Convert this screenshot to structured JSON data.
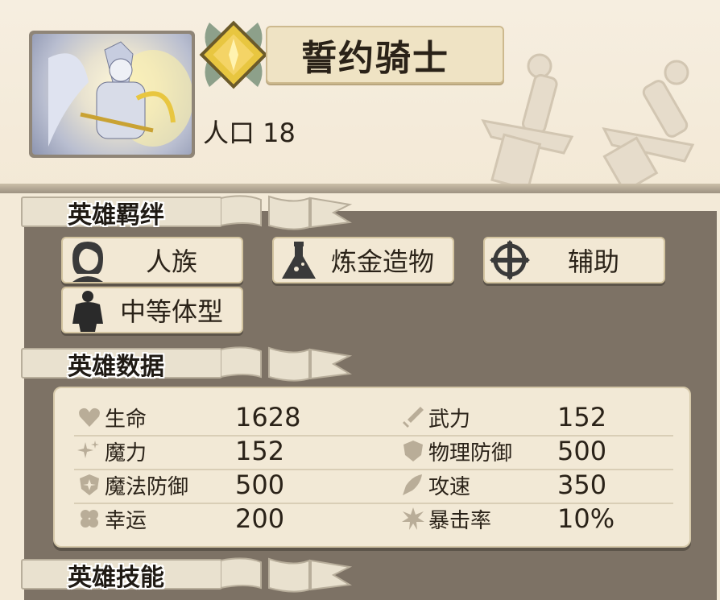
{
  "hero": {
    "name": "誓约骑士",
    "population": "人口 18"
  },
  "bonds": {
    "title": "英雄羁绊",
    "items": [
      {
        "label": "人族",
        "icon": "human-face-icon"
      },
      {
        "label": "炼金造物",
        "icon": "flask-icon"
      },
      {
        "label": "辅助",
        "icon": "support-cross-icon"
      },
      {
        "label": "中等体型",
        "icon": "medium-body-icon"
      }
    ]
  },
  "stats": {
    "title": "英雄数据",
    "left": [
      {
        "name": "生命",
        "value": "1628",
        "icon": "heart-icon"
      },
      {
        "name": "魔力",
        "value": "152",
        "icon": "sparkle-icon"
      },
      {
        "name": "魔法防御",
        "value": "500",
        "icon": "magic-shield-icon"
      },
      {
        "name": "幸运",
        "value": "200",
        "icon": "clover-icon"
      }
    ],
    "right": [
      {
        "name": "武力",
        "value": "152",
        "icon": "sword-icon"
      },
      {
        "name": "物理防御",
        "value": "500",
        "icon": "shield-icon"
      },
      {
        "name": "攻速",
        "value": "350",
        "icon": "wing-icon"
      },
      {
        "name": "暴击率",
        "value": "10%",
        "icon": "burst-icon"
      }
    ]
  },
  "skills": {
    "title": "英雄技能"
  },
  "colors": {
    "panel_brown": "#7d7265",
    "parchment": "#f2e9d6",
    "gold": "#c9a233"
  }
}
